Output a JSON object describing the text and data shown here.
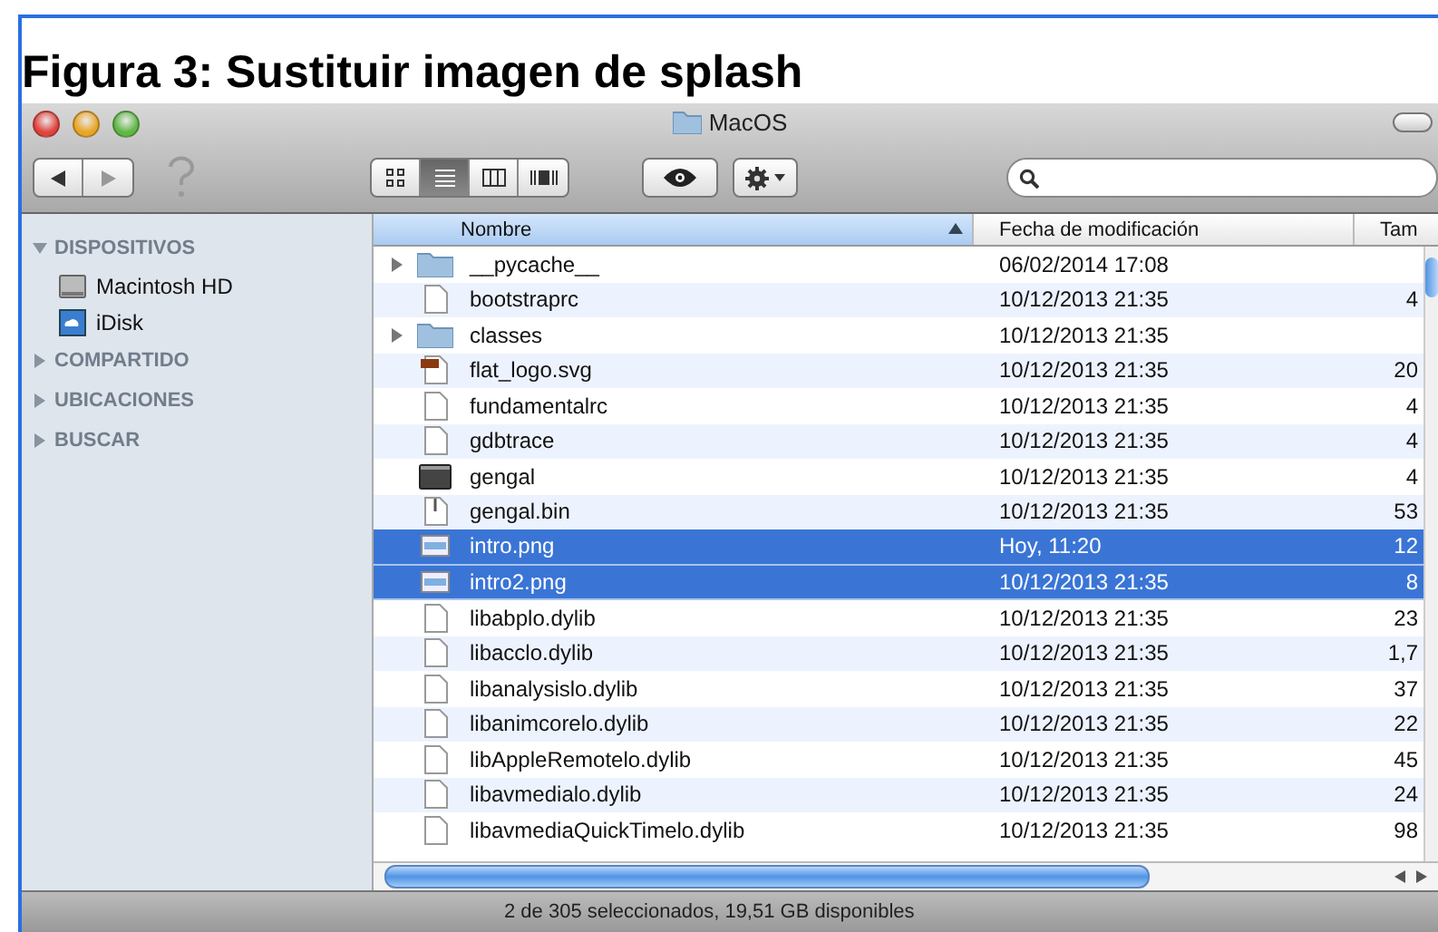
{
  "caption": "Figura 3: Sustituir imagen de splash",
  "window": {
    "title": "MacOS"
  },
  "toolbar": {
    "views": [
      {
        "kind": "icons",
        "selected": false
      },
      {
        "kind": "list",
        "selected": true
      },
      {
        "kind": "columns",
        "selected": false
      },
      {
        "kind": "coverflow",
        "selected": false
      }
    ]
  },
  "sidebar": {
    "sections": [
      {
        "label": "DISPOSITIVOS",
        "expanded": true,
        "items": [
          {
            "label": "Macintosh HD",
            "kind": "disk"
          },
          {
            "label": "iDisk",
            "kind": "idisk"
          }
        ]
      },
      {
        "label": "COMPARTIDO",
        "expanded": false
      },
      {
        "label": "UBICACIONES",
        "expanded": false
      },
      {
        "label": "BUSCAR",
        "expanded": false
      }
    ]
  },
  "table": {
    "columns": [
      {
        "label": "Nombre",
        "sorted": true
      },
      {
        "label": "Fecha de modificación",
        "sorted": false
      },
      {
        "label": "Tam",
        "sorted": false
      }
    ],
    "rows": [
      {
        "kind": "folder",
        "name": "__pycache__",
        "date": "06/02/2014 17:08",
        "selected": false
      },
      {
        "kind": "file",
        "name": "bootstraprc",
        "date": "10/12/2013 21:35",
        "size": "4",
        "selected": false
      },
      {
        "kind": "folder",
        "name": "classes",
        "date": "10/12/2013 21:35",
        "selected": false
      },
      {
        "kind": "svg",
        "name": "flat_logo.svg",
        "date": "10/12/2013 21:35",
        "size": "20",
        "selected": false
      },
      {
        "kind": "file",
        "name": "fundamentalrc",
        "date": "10/12/2013 21:35",
        "size": "4",
        "selected": false
      },
      {
        "kind": "file",
        "name": "gdbtrace",
        "date": "10/12/2013 21:35",
        "size": "4",
        "selected": false
      },
      {
        "kind": "exec",
        "name": "gengal",
        "date": "10/12/2013 21:35",
        "size": "4",
        "selected": false
      },
      {
        "kind": "bin",
        "name": "gengal.bin",
        "date": "10/12/2013 21:35",
        "size": "53",
        "selected": false
      },
      {
        "kind": "image",
        "name": "intro.png",
        "date": "Hoy, 11:20",
        "size": "12",
        "selected": true
      },
      {
        "kind": "image",
        "name": "intro2.png",
        "date": "10/12/2013 21:35",
        "size": "8",
        "selected": true
      },
      {
        "kind": "file",
        "name": "libabplo.dylib",
        "date": "10/12/2013 21:35",
        "size": "23",
        "selected": false
      },
      {
        "kind": "file",
        "name": "libacclo.dylib",
        "date": "10/12/2013 21:35",
        "size": "1,7",
        "selected": false
      },
      {
        "kind": "file",
        "name": "libanalysislo.dylib",
        "date": "10/12/2013 21:35",
        "size": "37",
        "selected": false
      },
      {
        "kind": "file",
        "name": "libanimcorelo.dylib",
        "date": "10/12/2013 21:35",
        "size": "22",
        "selected": false
      },
      {
        "kind": "file",
        "name": "libAppleRemotelo.dylib",
        "date": "10/12/2013 21:35",
        "size": "45",
        "selected": false
      },
      {
        "kind": "file",
        "name": "libavmedialo.dylib",
        "date": "10/12/2013 21:35",
        "size": "24",
        "selected": false
      },
      {
        "kind": "file",
        "name": "libavmediaQuickTimelo.dylib",
        "date": "10/12/2013 21:35",
        "size": "98",
        "selected": false
      }
    ]
  },
  "status_bar": "2 de 305 seleccionados, 19,51 GB disponibles"
}
